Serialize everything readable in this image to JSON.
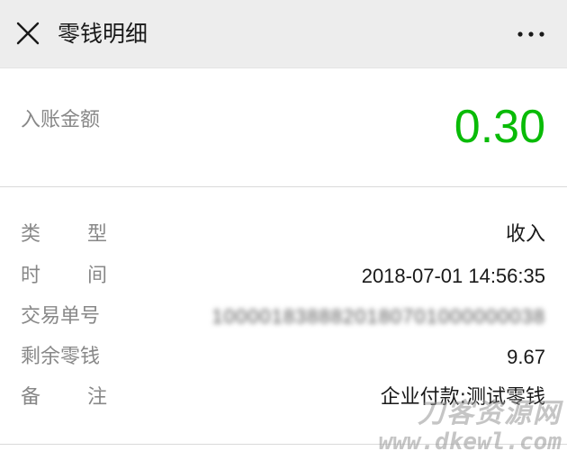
{
  "header": {
    "title": "零钱明细",
    "close_icon": "close-icon",
    "more_icon": "more-dots-icon"
  },
  "amount": {
    "label": "入账金额",
    "value": "0.30",
    "color": "#09bb07"
  },
  "details": {
    "type": {
      "label_chars": [
        "类",
        "型"
      ],
      "value": "收入"
    },
    "time": {
      "label_chars": [
        "时",
        "间"
      ],
      "value": "2018-07-01 14:56:35"
    },
    "order_no": {
      "label": "交易单号",
      "value": "1000018388820180701000000038"
    },
    "balance": {
      "label": "剩余零钱",
      "value": "9.67"
    },
    "note": {
      "label_chars": [
        "备",
        "注"
      ],
      "value": "企业付款:测试零钱"
    }
  },
  "watermark": {
    "title": "刀客资源网",
    "url": "www.dkewl.com"
  }
}
